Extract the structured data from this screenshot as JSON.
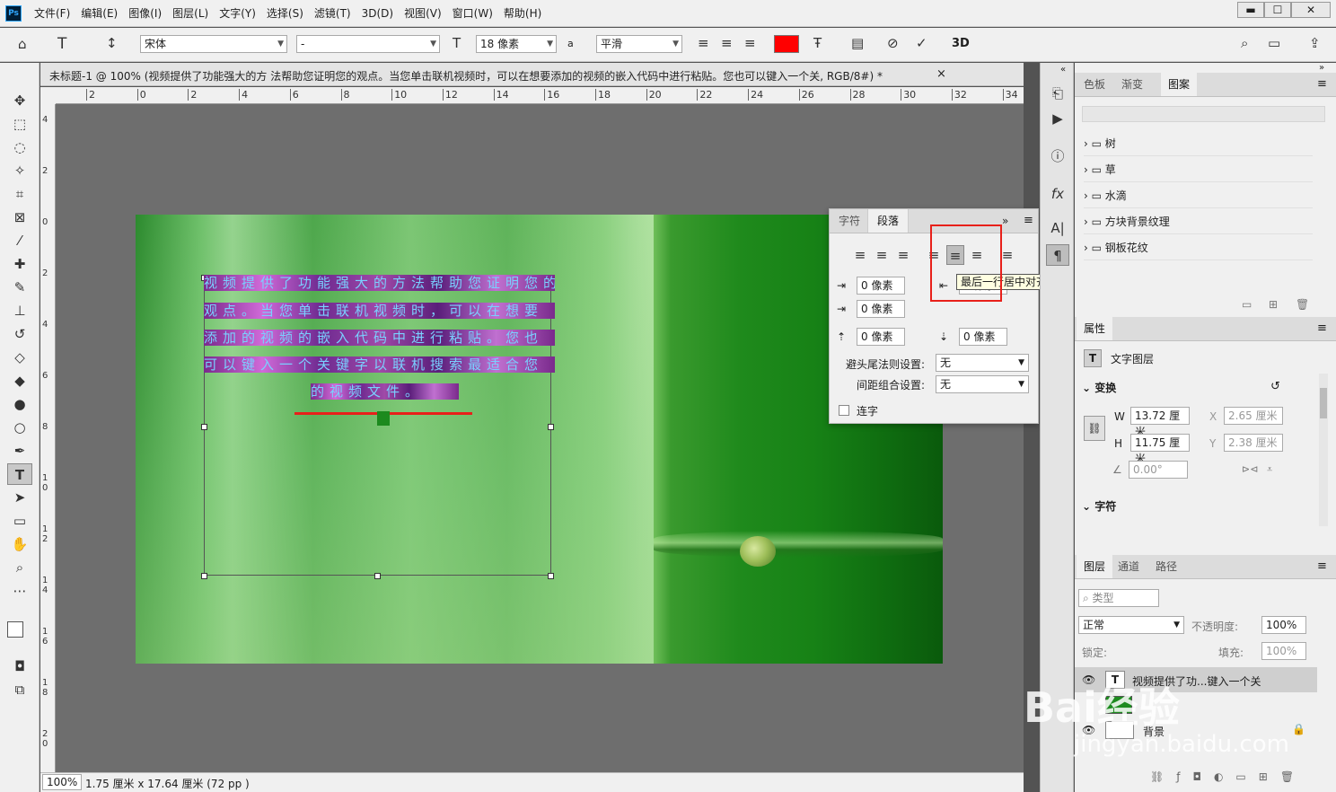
{
  "menubar": {
    "logo": "Ps",
    "items": [
      "文件(F)",
      "编辑(E)",
      "图像(I)",
      "图层(L)",
      "文字(Y)",
      "选择(S)",
      "滤镜(T)",
      "3D(D)",
      "视图(V)",
      "窗口(W)",
      "帮助(H)"
    ],
    "min": "▬",
    "max": "☐",
    "close": "✕"
  },
  "options": {
    "font_family": "宋体",
    "font_style": "-",
    "font_size": "18 像素",
    "aa_label": "a",
    "antialias": "平滑",
    "text_color": "#ff0000",
    "mode_3d": "3D"
  },
  "document": {
    "tab_title": "未标题-1 @ 100% (视频提供了功能强大的方 法帮助您证明您的观点。当您单击联机视频时，可以在想要添加的视频的嵌入代码中进行粘贴。您也可以键入一个关, RGB/8#) *",
    "close": "×"
  },
  "ruler_h": [
    "2",
    "0",
    "2",
    "4",
    "6",
    "8",
    "10",
    "12",
    "14",
    "16",
    "18",
    "20",
    "22",
    "24",
    "26",
    "28",
    "30",
    "32",
    "34"
  ],
  "ruler_v": [
    "4",
    "2",
    "0",
    "2",
    "4",
    "6",
    "8",
    "1\n0",
    "1\n2",
    "1\n4",
    "1\n6",
    "1\n8",
    "2\n0"
  ],
  "canvas_text": {
    "line1": "视频提供了功能强大的方法帮助您证明您的",
    "line2": "观点。当您单击联机视频时，可以在想要",
    "line3": "添加的视频的嵌入代码中进行粘贴。您也",
    "line4": "可以键入一个关键字以联机搜索最适合您",
    "line5": "的视频文件。"
  },
  "status": {
    "zoom": "100%",
    "size": "1.75 厘米 x 17.64 厘米 (72 pp )"
  },
  "paragraph_panel": {
    "tab_char": "字符",
    "tab_para": "段落",
    "collapse": "»",
    "indent_left": "0 像素",
    "indent_right": "0 像素",
    "indent_first": "0 像素",
    "space_before": "0 像素",
    "space_after": "0 像素",
    "kinsoku_label": "避头尾法则设置:",
    "kinsoku_value": "无",
    "mojikumi_label": "间距组合设置:",
    "mojikumi_value": "无",
    "hyphen_label": "连字",
    "tooltip": "最后一行居中对齐"
  },
  "swatches_panel": {
    "tabs": [
      "色板",
      "渐变",
      "图案"
    ],
    "folders": [
      "树",
      "草",
      "水滴",
      "方块背景纹理",
      "钢板花纹"
    ]
  },
  "properties_panel": {
    "tab": "属性",
    "layer_type": "文字图层",
    "transform": "变换",
    "w_label": "W",
    "w_value": "13.72 厘米",
    "x_label": "X",
    "x_value": "2.65 厘米",
    "h_label": "H",
    "h_value": "11.75 厘米",
    "y_label": "Y",
    "y_value": "2.38 厘米",
    "angle": "0.00°",
    "char_section": "字符"
  },
  "layers_panel": {
    "tabs": [
      "图层",
      "通道",
      "路径"
    ],
    "kind": "类型",
    "blend": "正常",
    "opacity_label": "不透明度:",
    "opacity": "100%",
    "lock_label": "锁定:",
    "fill_label": "填充:",
    "fill": "100%",
    "layers": [
      {
        "name": "视频提供了功...键入一个关"
      },
      {
        "name": "背景"
      }
    ]
  },
  "watermark": {
    "brand": "Bai经验",
    "url": "jingyan.baidu.com"
  }
}
